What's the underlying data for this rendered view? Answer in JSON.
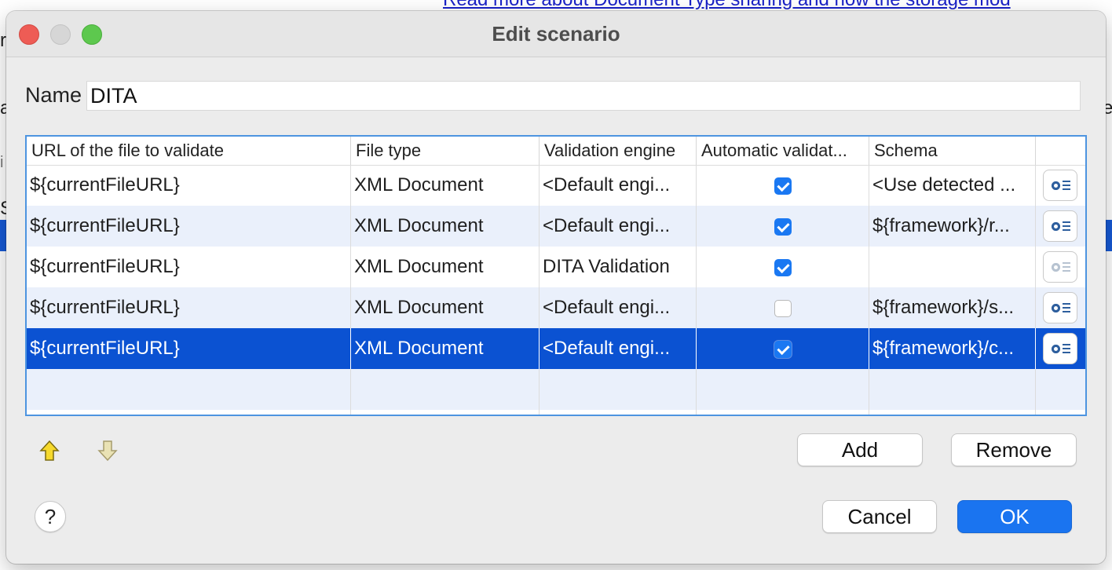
{
  "background": {
    "link_text": "Read more about Document Type sharing and how the storage mod",
    "frag_a": "a",
    "frag_r": "r",
    "frag_e": "e",
    "frag_i": "i",
    "frag_s": "S"
  },
  "dialog": {
    "title": "Edit scenario",
    "name_label": "Name",
    "name_value": "DITA"
  },
  "table": {
    "columns": [
      "URL of the file to validate",
      "File type",
      "Validation engine",
      "Automatic validat...",
      "Schema"
    ],
    "rows": [
      {
        "url": "${currentFileURL}",
        "file_type": "XML Document",
        "engine": "<Default engi...",
        "auto": true,
        "schema": "<Use detected ...",
        "edit_enabled": true
      },
      {
        "url": "${currentFileURL}",
        "file_type": "XML Document",
        "engine": "<Default engi...",
        "auto": true,
        "schema": "${framework}/r...",
        "edit_enabled": true
      },
      {
        "url": "${currentFileURL}",
        "file_type": "XML Document",
        "engine": "DITA Validation",
        "auto": true,
        "schema": "",
        "edit_enabled": false
      },
      {
        "url": "${currentFileURL}",
        "file_type": "XML Document",
        "engine": "<Default engi...",
        "auto": false,
        "schema": "${framework}/s...",
        "edit_enabled": true
      },
      {
        "url": "${currentFileURL}",
        "file_type": "XML Document",
        "engine": "<Default engi...",
        "auto": true,
        "schema": "${framework}/c...",
        "edit_enabled": true
      }
    ],
    "selected_row": 4
  },
  "buttons": {
    "add": "Add",
    "remove": "Remove",
    "cancel": "Cancel",
    "ok": "OK",
    "help": "?"
  },
  "icons": {
    "move_up": "arrow-up-icon",
    "move_down": "arrow-down-icon",
    "edit": "gear-list-icon"
  },
  "colors": {
    "selection": "#0b52d2",
    "accent": "#1a74f0",
    "alt_row": "#eaf0fb"
  }
}
